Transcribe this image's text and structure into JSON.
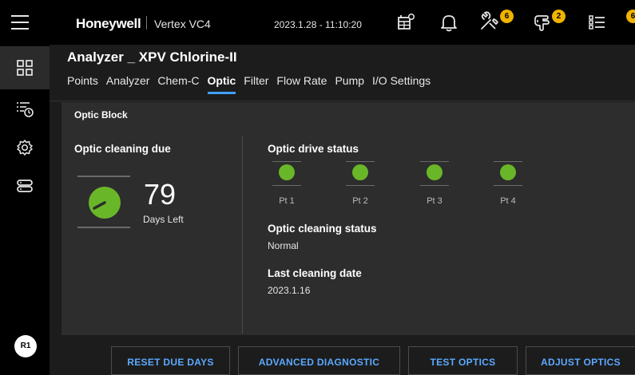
{
  "header": {
    "brand": "Honeywell",
    "device": "Vertex VC4",
    "datetime": "2023.1.28 - 11:10:20",
    "icons": [
      "menu-icon",
      "calendar-gear-icon",
      "bell-icon",
      "tools-icon",
      "fault-hand-icon",
      "list-icon"
    ],
    "tools_badge": "6",
    "fault_badge": "2",
    "list_badge": "6",
    "badge_color": "#f0b400"
  },
  "sidebar": {
    "items": [
      {
        "icon": "dashboard-grid-icon",
        "active": true
      },
      {
        "icon": "history-list-icon",
        "active": false
      },
      {
        "icon": "settings-gear-icon",
        "active": false
      },
      {
        "icon": "server-icon",
        "active": false
      }
    ],
    "user_initials": "R1"
  },
  "page": {
    "title": "Analyzer _ XPV Chlorine-II",
    "tabs": [
      {
        "label": "Points",
        "active": false
      },
      {
        "label": "Analyzer",
        "active": false
      },
      {
        "label": "Chem-C",
        "active": false
      },
      {
        "label": "Optic",
        "active": true
      },
      {
        "label": "Filter",
        "active": false
      },
      {
        "label": "Flow Rate",
        "active": false
      },
      {
        "label": "Pump",
        "active": false
      },
      {
        "label": "I/O Settings",
        "active": false
      }
    ]
  },
  "panel": {
    "title": "Optic Block",
    "cleaning_due": {
      "label": "Optic cleaning due",
      "days": "79",
      "unit": "Days Left",
      "gauge_color": "#6ab629"
    },
    "drive_status": {
      "label": "Optic drive status",
      "points": [
        {
          "name": "Pt 1",
          "status_color": "#6ab629"
        },
        {
          "name": "Pt 2",
          "status_color": "#6ab629"
        },
        {
          "name": "Pt 3",
          "status_color": "#6ab629"
        },
        {
          "name": "Pt 4",
          "status_color": "#6ab629"
        }
      ]
    },
    "cleaning_status": {
      "label": "Optic cleaning status",
      "value": "Normal"
    },
    "last_cleaning": {
      "label": "Last cleaning date",
      "value": "2023.1.16"
    }
  },
  "actions": {
    "reset": "RESET DUE DAYS",
    "advanced": "ADVANCED DIAGNOSTIC",
    "test": "TEST OPTICS",
    "adjust": "ADJUST OPTICS"
  },
  "colors": {
    "accent": "#3ea0ff",
    "button_text": "#5aa9ff",
    "status_green": "#6ab629",
    "panel_bg": "#2d2d2d"
  }
}
